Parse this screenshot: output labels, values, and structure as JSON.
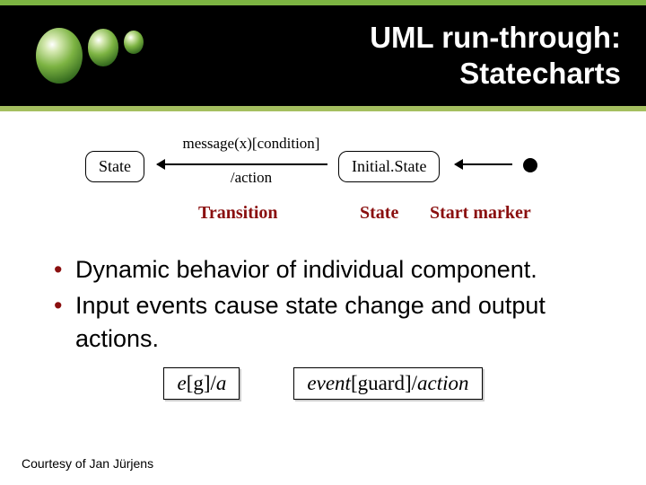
{
  "header": {
    "title_line1": "UML run-through:",
    "title_line2": "Statecharts"
  },
  "diagram": {
    "state_label": "State",
    "initial_state_label": "Initial.State",
    "transition_top": "message(x)[condition]",
    "transition_bottom": "/action",
    "label_transition": "Transition",
    "label_state": "State",
    "label_start": "Start marker"
  },
  "bullets": [
    "Dynamic behavior of individual component.",
    "Input events cause state change and output actions."
  ],
  "notation": {
    "short_e": "e",
    "short_g": "[g]/",
    "short_a": "a",
    "long_event": "event",
    "long_guard": "[guard]/",
    "long_action": "action"
  },
  "footer": {
    "courtesy": "Courtesy of Jan Jürjens"
  }
}
